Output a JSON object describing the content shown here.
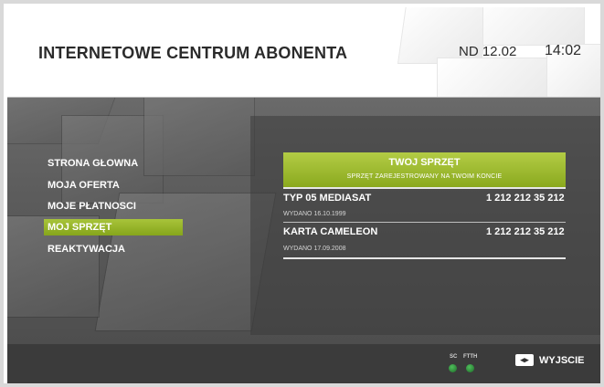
{
  "header": {
    "title": "INTERNETOWE CENTRUM ABONENTA",
    "date": "ND 12.02",
    "time": "14:02"
  },
  "menu": {
    "items": [
      {
        "label": "STRONA GŁOWNA",
        "active": false
      },
      {
        "label": "MOJA OFERTA",
        "active": false
      },
      {
        "label": "MOJE PŁATNOSCI",
        "active": false
      },
      {
        "label": "MOJ SPRZĘT",
        "active": true
      },
      {
        "label": "REAKTYWACJA",
        "active": false
      }
    ]
  },
  "panel": {
    "title": "TWOJ SPRZĘT",
    "subtitle": "SPRZĘT ZAREJESTROWANY NA TWOIM KONCIE",
    "devices": [
      {
        "name": "TYP 05  MEDIASAT",
        "number": "1 212 212 35 212",
        "issued": "WYDANO 16.10.1999"
      },
      {
        "name": "KARTA CAMELEON",
        "number": "1 212 212 35 212",
        "issued": "WYDANO 17.09.2008"
      }
    ]
  },
  "footer": {
    "indicators": [
      {
        "label": "SC",
        "status": "on"
      },
      {
        "label": "FTTH",
        "status": "on"
      }
    ],
    "exit_icon_glyph": "◂▸",
    "exit_label": "WYJSCIE"
  },
  "colors": {
    "accent": "#9cba2c",
    "indicator": "#3fae4c",
    "footer_bg": "#3b3b3b"
  }
}
